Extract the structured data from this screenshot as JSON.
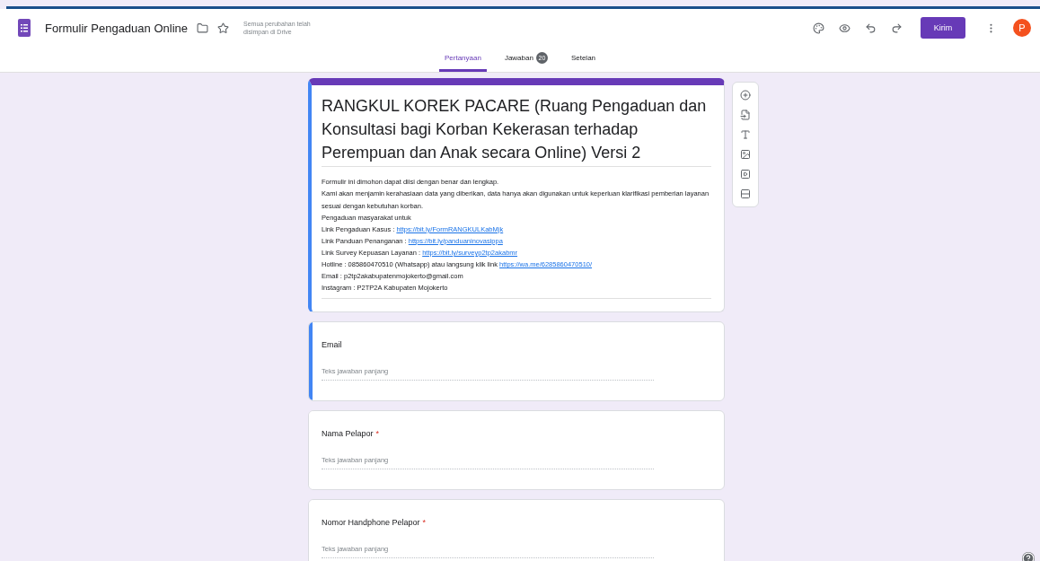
{
  "header": {
    "title": "Formulir Pengaduan Online",
    "save_status": "Semua perubahan telah disimpan di Drive",
    "send_button": "Kirim",
    "avatar": "P"
  },
  "tabs": [
    {
      "label": "Pertanyaan",
      "selected": true
    },
    {
      "label": "Jawaban",
      "badge": "20",
      "selected": false
    },
    {
      "label": "Setelan",
      "selected": false
    }
  ],
  "form": {
    "title": "RANGKUL KOREK PACARE (Ruang Pengaduan dan Konsultasi bagi Korban Kekerasan terhadap Perempuan dan Anak secara Online) Versi 2",
    "description": [
      {
        "text": "Formulir ini dimohon dapat diisi dengan benar dan lengkap."
      },
      {
        "text": "Kami akan menjamin kerahasiaan data yang diberikan, data hanya akan digunakan untuk keperluan klarifikasi pemberian layanan sesuai dengan kebutuhan korban."
      },
      {
        "text": "Pengaduan masyarakat untuk"
      },
      {
        "text": "Link Pengaduan Kasus :",
        "link": "https://bit.ly/FormRANGKULKabMjk"
      },
      {
        "text": "Link Panduan Penanganan :",
        "link": "https://bit.ly/panduaninovasippa"
      },
      {
        "text": "Link Survey Kepuasan Layanan :",
        "link": "https://bit.ly/surveyp2tp2akabmr"
      },
      {
        "text": "Hotline : 085860470510 (Whatsapp) atau langsung klik link",
        "link": "https://wa.me/6285860470510/"
      },
      {
        "text": "Email : p2tp2akabupatenmojokerto@gmail.com"
      },
      {
        "text": "Instagram : P2TP2A Kabupaten Mojokerto"
      }
    ]
  },
  "questions": [
    {
      "title": "Email",
      "placeholder": "Teks jawaban panjang",
      "selected": true
    },
    {
      "title": "Nama Pelapor",
      "required_mark": "*",
      "placeholder": "Teks jawaban panjang",
      "selected": false
    },
    {
      "title": "Nomor Handphone Pelapor",
      "required_mark": "*",
      "placeholder": "Teks jawaban panjang",
      "selected": false
    }
  ]
}
